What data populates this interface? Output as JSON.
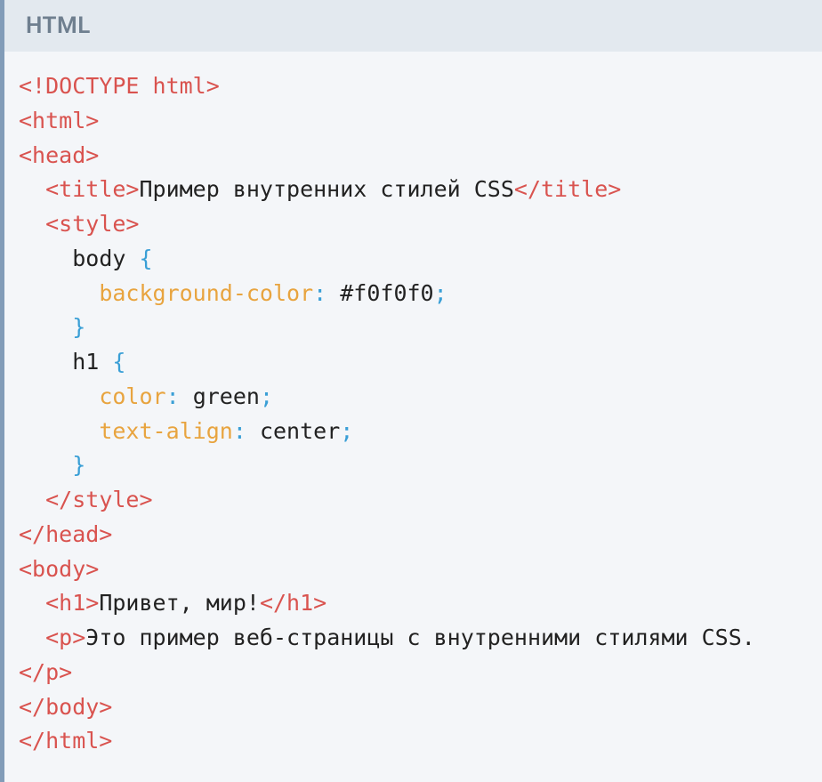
{
  "header": {
    "label": "HTML"
  },
  "code": {
    "l1": {
      "doctype": "<!DOCTYPE html>"
    },
    "l2": {
      "tag": "<html>"
    },
    "l3": {
      "tag": "<head>"
    },
    "l4": {
      "indent": "  ",
      "open": "<title>",
      "text": "Пример внутренних стилей CSS",
      "close": "</title>"
    },
    "l5": {
      "indent": "  ",
      "tag": "<style>"
    },
    "l6": {
      "indent": "    ",
      "sel": "body ",
      "brace": "{"
    },
    "l7": {
      "indent": "      ",
      "prop": "background-color",
      "colon": ": ",
      "val": "#f0f0f0",
      "semi": ";"
    },
    "l8": {
      "indent": "    ",
      "brace": "}"
    },
    "l9": {
      "indent": "    ",
      "sel": "h1 ",
      "brace": "{"
    },
    "l10": {
      "indent": "      ",
      "prop": "color",
      "colon": ": ",
      "val": "green",
      "semi": ";"
    },
    "l11": {
      "indent": "      ",
      "prop": "text-align",
      "colon": ": ",
      "val": "center",
      "semi": ";"
    },
    "l12": {
      "indent": "    ",
      "brace": "}"
    },
    "l13": {
      "indent": "  ",
      "tag": "</style>"
    },
    "l14": {
      "tag": "</head>"
    },
    "l15": {
      "tag": "<body>"
    },
    "l16": {
      "indent": "  ",
      "open": "<h1>",
      "text": "Привет, мир!",
      "close": "</h1>"
    },
    "l17": {
      "indent": "  ",
      "open": "<p>",
      "text": "Это пример веб-страницы с внутренними стилями CSS.",
      "close": "</p>"
    },
    "l18": {
      "tag": "</body>"
    },
    "l19": {
      "tag": "</html>"
    }
  }
}
